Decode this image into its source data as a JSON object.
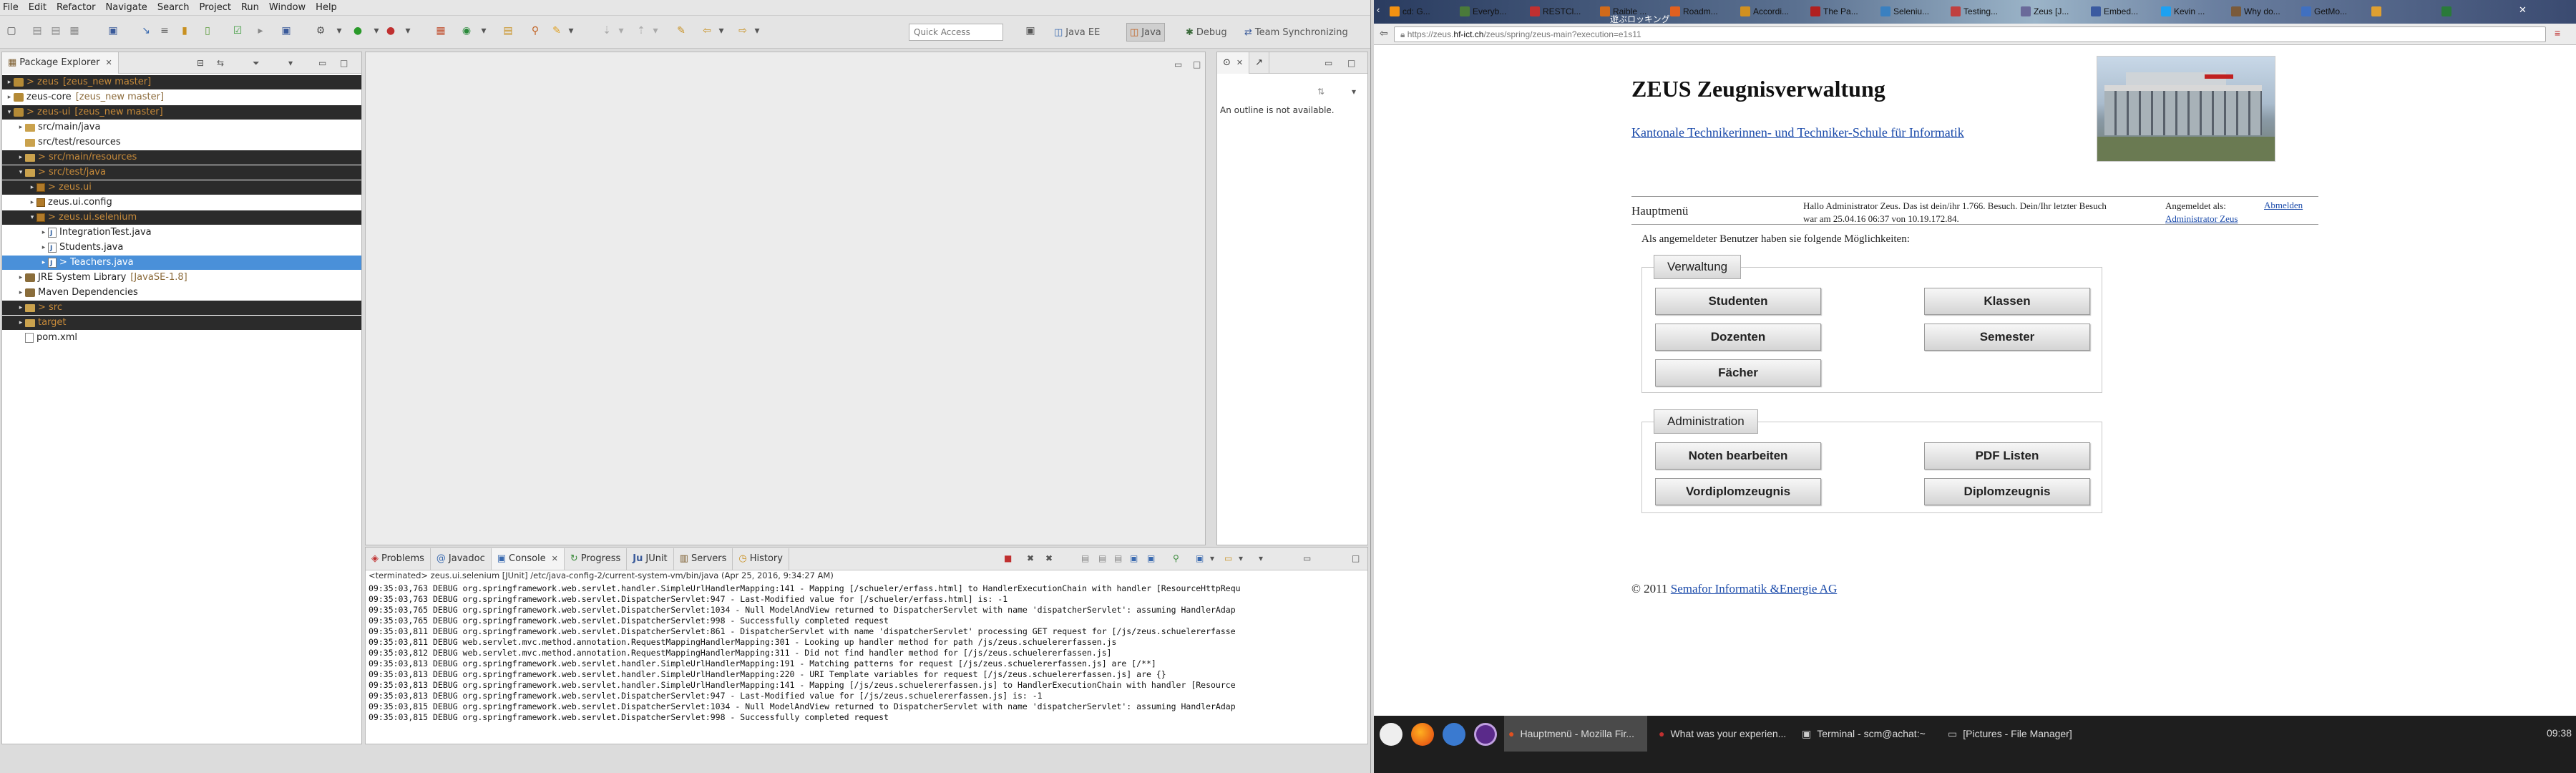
{
  "eclipse": {
    "menus": [
      "File",
      "Edit",
      "Refactor",
      "Navigate",
      "Search",
      "Project",
      "Run",
      "Window",
      "Help"
    ],
    "quick_access_placeholder": "Quick Access",
    "perspectives": [
      "Java EE",
      "Java",
      "Debug",
      "Team Synchronizing"
    ],
    "package_explorer": {
      "title": "Package Explorer",
      "rows": [
        {
          "name": "> zeus",
          "dec": "[zeus_new master]",
          "indent": 0,
          "icon": "project",
          "style": "dark",
          "twisty": "▸"
        },
        {
          "name": "zeus-core",
          "dec": "[zeus_new master]",
          "indent": 0,
          "icon": "project",
          "style": "normal",
          "twisty": "▸"
        },
        {
          "name": "> zeus-ui",
          "dec": "[zeus_new master]",
          "indent": 0,
          "icon": "project",
          "style": "dark",
          "twisty": "▾"
        },
        {
          "name": "src/main/java",
          "dec": "",
          "indent": 1,
          "icon": "folder",
          "style": "normal",
          "twisty": "▸"
        },
        {
          "name": "src/test/resources",
          "dec": "",
          "indent": 1,
          "icon": "folder",
          "style": "normal",
          "twisty": ""
        },
        {
          "name": "> src/main/resources",
          "dec": "",
          "indent": 1,
          "icon": "folder",
          "style": "dark",
          "twisty": "▸"
        },
        {
          "name": "> src/test/java",
          "dec": "",
          "indent": 1,
          "icon": "folder",
          "style": "dark",
          "twisty": "▾"
        },
        {
          "name": "> zeus.ui",
          "dec": "",
          "indent": 2,
          "icon": "package",
          "style": "dark",
          "twisty": "▸"
        },
        {
          "name": "zeus.ui.config",
          "dec": "",
          "indent": 2,
          "icon": "package",
          "style": "normal",
          "twisty": "▸"
        },
        {
          "name": "> zeus.ui.selenium",
          "dec": "",
          "indent": 2,
          "icon": "package",
          "style": "dark",
          "twisty": "▾"
        },
        {
          "name": "IntegrationTest.java",
          "dec": "",
          "indent": 3,
          "icon": "java",
          "style": "normal",
          "twisty": "▸"
        },
        {
          "name": "Students.java",
          "dec": "",
          "indent": 3,
          "icon": "java",
          "style": "normal",
          "twisty": "▸"
        },
        {
          "name": "> Teachers.java",
          "dec": "",
          "indent": 3,
          "icon": "java",
          "style": "selected",
          "twisty": "▸"
        },
        {
          "name": "JRE System Library",
          "dec": "[JavaSE-1.8]",
          "indent": 1,
          "icon": "jar",
          "style": "normal",
          "twisty": "▸"
        },
        {
          "name": "Maven Dependencies",
          "dec": "",
          "indent": 1,
          "icon": "jar",
          "style": "normal",
          "twisty": "▸"
        },
        {
          "name": "> src",
          "dec": "",
          "indent": 1,
          "icon": "folder",
          "style": "dark",
          "twisty": "▸"
        },
        {
          "name": "target",
          "dec": "",
          "indent": 1,
          "icon": "folder",
          "style": "dark",
          "twisty": "▸"
        },
        {
          "name": "pom.xml",
          "dec": "",
          "indent": 1,
          "icon": "xml",
          "style": "normal",
          "twisty": ""
        }
      ]
    },
    "outline": {
      "message": "An outline is not available."
    },
    "bottom_tabs": [
      "Problems",
      "Javadoc",
      "Console",
      "Progress",
      "JUnit",
      "Servers",
      "History"
    ],
    "console": {
      "status": "<terminated> zeus.ui.selenium [JUnit] /etc/java-config-2/current-system-vm/bin/java (Apr 25, 2016, 9:34:27 AM)",
      "lines": [
        "09:35:03,763 DEBUG org.springframework.web.servlet.handler.SimpleUrlHandlerMapping:141 - Mapping [/schueler/erfass.html] to HandlerExecutionChain with handler [ResourceHttpRequ",
        "09:35:03,763 DEBUG org.springframework.web.servlet.DispatcherServlet:947 - Last-Modified value for [/schueler/erfass.html] is: -1",
        "09:35:03,765 DEBUG org.springframework.web.servlet.DispatcherServlet:1034 - Null ModelAndView returned to DispatcherServlet with name 'dispatcherServlet': assuming HandlerAdap",
        "09:35:03,765 DEBUG org.springframework.web.servlet.DispatcherServlet:998 - Successfully completed request",
        "09:35:03,811 DEBUG org.springframework.web.servlet.DispatcherServlet:861 - DispatcherServlet with name 'dispatcherServlet' processing GET request for [/js/zeus.schuelererfasse",
        "09:35:03,811 DEBUG web.servlet.mvc.method.annotation.RequestMappingHandlerMapping:301 - Looking up handler method for path /js/zeus.schuelererfassen.js",
        "09:35:03,812 DEBUG web.servlet.mvc.method.annotation.RequestMappingHandlerMapping:311 - Did not find handler method for [/js/zeus.schuelererfassen.js]",
        "09:35:03,813 DEBUG org.springframework.web.servlet.handler.SimpleUrlHandlerMapping:191 - Matching patterns for request [/js/zeus.schuelererfassen.js] are [/**]",
        "09:35:03,813 DEBUG org.springframework.web.servlet.handler.SimpleUrlHandlerMapping:220 - URI Template variables for request [/js/zeus.schuelererfassen.js] are {}",
        "09:35:03,813 DEBUG org.springframework.web.servlet.handler.SimpleUrlHandlerMapping:141 - Mapping [/js/zeus.schuelererfassen.js] to HandlerExecutionChain with handler [Resource",
        "09:35:03,813 DEBUG org.springframework.web.servlet.DispatcherServlet:947 - Last-Modified value for [/js/zeus.schuelererfassen.js] is: -1",
        "09:35:03,815 DEBUG org.springframework.web.servlet.DispatcherServlet:1034 - Null ModelAndView returned to DispatcherServlet with name 'dispatcherServlet': assuming HandlerAdap",
        "09:35:03,815 DEBUG org.springframework.web.servlet.DispatcherServlet:998 - Successfully completed request"
      ]
    }
  },
  "firefox": {
    "tabs": [
      {
        "label": "cd: G...",
        "color": "#f29111"
      },
      {
        "label": "Everyb...",
        "color": "#4a7a3a"
      },
      {
        "label": "RESTCl...",
        "color": "#c03030"
      },
      {
        "label": "Raible ...",
        "color": "#d06a1a"
      },
      {
        "label": "Roadm...",
        "color": "#e06020"
      },
      {
        "label": "Accordi...",
        "color": "#d09020"
      },
      {
        "label": "The Pa...",
        "color": "#b02020"
      },
      {
        "label": "Seleniu...",
        "color": "#3a80c0"
      },
      {
        "label": "Testing...",
        "color": "#c04040"
      },
      {
        "label": "Zeus [J...",
        "color": "#6a6a9a"
      },
      {
        "label": "Embed...",
        "color": "#3a5aa0"
      },
      {
        "label": "Kevin ...",
        "color": "#1da1f2"
      },
      {
        "label": "Why do...",
        "color": "#7a5a3a"
      },
      {
        "label": "GetMo...",
        "color": "#4070c0"
      },
      {
        "label": "",
        "color": "#e0a030"
      },
      {
        "label": "",
        "color": "#2a7a3a"
      }
    ],
    "banner_text": "遊ぶロッキング",
    "url_prefix": "https://zeus.",
    "url_host": "hf-ict.ch",
    "url_path": "/zeus/spring/zeus-main?execution=e1s11"
  },
  "zeus": {
    "title": "ZEUS Zeugnisverwaltung",
    "school_link": "Kantonale Technikerinnen- und Techniker-Schule für Informatik",
    "main_menu": "Hauptmenü",
    "welcome": "Hallo Administrator Zeus. Das ist dein/ihr 1.766. Besuch. Dein/Ihr letzter Besuch war am 25.04.16 06:37 von 10.19.172.84.",
    "logged_in_label": "Angemeldet als:",
    "logged_in_user": "Administrator Zeus",
    "logout": "Abmelden",
    "intro": "Als angemeldeter Benutzer haben sie folgende Möglichkeiten:",
    "verwaltung": {
      "legend": "Verwaltung",
      "buttons": [
        "Studenten",
        "Klassen",
        "Dozenten",
        "Semester",
        "Fächer"
      ]
    },
    "administration": {
      "legend": "Administration",
      "buttons": [
        "Noten bearbeiten",
        "PDF Listen",
        "Vordiplomzeugnis",
        "Diplomzeugnis"
      ]
    },
    "footer_prefix": "© 2011",
    "footer_link": "Semafor Informatik &Energie AG"
  },
  "taskbar": {
    "items": [
      "Hauptmenü - Mozilla Fir...",
      "What was your experien...",
      "Terminal - scm@achat:~",
      "[Pictures - File Manager]"
    ],
    "clock": "09:38"
  }
}
